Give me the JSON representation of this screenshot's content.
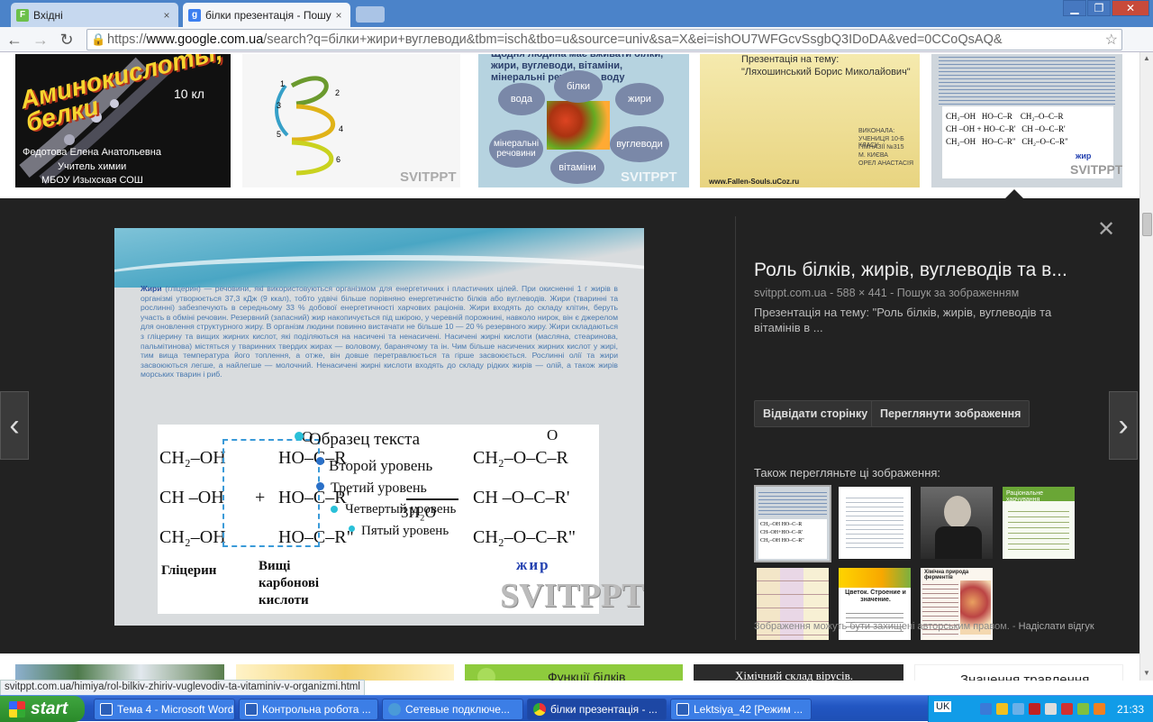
{
  "tabs": [
    {
      "title": "Вхідні",
      "close": "×"
    },
    {
      "title": "білки презентація - Пошу",
      "close": "×"
    }
  ],
  "url": {
    "scheme": "https://",
    "host": "www.google.com.ua",
    "path": "/search?q=білки+жири+вуглеводи&tbm=isch&tbo=u&source=univ&sa=X&ei=ishOU7WFGcvSsgbQ3IDoDA&ved=0CCoQsAQ&"
  },
  "thumbs": {
    "t1": {
      "title": "Аминокислоты, белки",
      "grade": "10 кл",
      "author": "Федотова Елена Анатольевна",
      "role": "Учитель химии",
      "school": "МБОУ Изыхская СОШ"
    },
    "t2": {
      "nums": [
        "1",
        "2",
        "3",
        "4",
        "5",
        "6"
      ],
      "wm": "SVITPPT"
    },
    "t3": {
      "head": "Щодня людина має вживати білки, жири, вуглеводи, вітаміни, мінеральні речовини, воду",
      "nodes": [
        "вода",
        "білки",
        "жири",
        "вуглеводи",
        "вітаміни",
        "мінеральні речовини"
      ],
      "wm": "SVITPPT"
    },
    "t4": {
      "l1": "Презентація на тему:",
      "l2": "\"Ляхошинський Борис Миколайович\"",
      "l3": "ВИКОНАЛА:",
      "l4": "УЧЕНИЦЯ 10-Б КЛАСУ",
      "l5": "ГІМНАЗІЇ №315",
      "l6": "М. КИЄВА",
      "l7": "ОРЕЛ АНАСТАСІЯ",
      "site": "www.Fallen-Souls.uCoz.ru"
    },
    "t5": {
      "wm": "SVITPPT",
      "label": "жир"
    }
  },
  "panel": {
    "title": "Роль білків, жирів, вуглеводів та в...",
    "source": "svitppt.com.ua",
    "size": "588 × 441",
    "search_by": "Пошук за зображенням",
    "desc": "Презентація на тему: \"Роль білків, жирів, вуглеводів та вітамінів в ...",
    "visit": "Відвідати сторінку",
    "view": "Переглянути зображення",
    "related": "Також перегляньте ці зображення:",
    "copyright": "Зображення можуть бути захищені авторським правом.",
    "feedback": "Надіслати відгук",
    "close": "✕",
    "prev": "‹",
    "next": "›"
  },
  "slide": {
    "lead": "Жири",
    "paragraph": "(гліцерин) — речовини, які використовуються організмом для енергетичних і пластичних цілей. При окисненні 1 г жирів в організмі утворюється 37,3 кДж (9 ккал), тобто удвічі більше порівняно енергетичністю білків або вуглеводів. Жири (тваринні та рослинні) забезпечують в середньому 33 % добової енергетичності харчових раціонів. Жири входять до складу клітин, беруть участь в обміні речовин. Резервний (запасний) жир накопичується під шкірою, у черевній порожнині, навколо нирок, він є джерелом для оновлення структурного жиру. В організм людини повинно вистачати не більше 10 — 20 % резервного жиру. Жири складаються з гліцерину та вищих жирних кислот, які поділяються на насичені та ненасичені. Насичені жирні кислоти (масляна, стеаринова, пальмітинова) містяться у тваринних твердих жирах — воловому, баранячому та ін. Чим більше насичених жирних кислот у жирі, тим вища температура його топлення, а отже, він довше перетравлюється та гірше засвоюється. Рослинні олії та жири засвоюються легше, а найлегше — молочний. Ненасичені жирні кислоти входять до складу рідких жирів — олій, а також жирів морських тварин і риб.",
    "r1a": "CH₂–OH",
    "r1b": "HO–C–R",
    "r1c": "CH₂–O–C–R",
    "r2a": "CH –OH",
    "plus": "+",
    "r2b": "HO–C–R'",
    "r2c": "CH –O–C–R'",
    "r3a": "CH₂–OH",
    "r3b": "HO–C–R\"",
    "r3c": "CH₂–O–C–R\"",
    "o": "O",
    "water": "3H₂O",
    "lvl1": "Образец текста",
    "lvl2": "Второй уровень",
    "lvl3": "Третий уровень",
    "lvl4": "Четвертый уровень",
    "lvl5": "Пятый уровень",
    "glycerin": "Гліцерин",
    "acids": "Вищі карбонові кислоти",
    "fat": "жир",
    "wm": "SVITPPT"
  },
  "related": [
    {
      "kind": "formula"
    },
    {
      "kind": "document"
    },
    {
      "kind": "portrait"
    },
    {
      "kind": "green",
      "title": "Раціональне харчування"
    },
    {
      "kind": "table"
    },
    {
      "kind": "cells",
      "title": "Цветок. Строение и значение."
    },
    {
      "kind": "ferments",
      "title": "Хімічна природа ферментів"
    }
  ],
  "bottom": [
    {
      "kind": "forest"
    },
    {
      "kind": "yellow"
    },
    {
      "kind": "green",
      "title": "Функції білків"
    },
    {
      "kind": "dark",
      "title": "Хімічний склад вірусів."
    },
    {
      "kind": "white",
      "title": "Значення травлення"
    }
  ],
  "status_url": "svitppt.com.ua/himiya/rol-bilkiv-zhiriv-vuglevodiv-ta-vitaminiv-v-organizmi.html",
  "taskbar": {
    "start": "start",
    "tasks": [
      "Тема 4 - Microsoft Word",
      "Контрольна робота ...",
      "Сетевые подключе...",
      "білки презентація - ...",
      "Lektsiya_42 [Режим ..."
    ],
    "lang": "UK",
    "clock": "21:33"
  },
  "colors": {
    "tabbar": "#4b83c9",
    "panel": "#222222",
    "taskbar": "#2256c2",
    "start": "#2a8a2a",
    "tray": "#119ce8",
    "slide_text": "#4a7ab0"
  }
}
